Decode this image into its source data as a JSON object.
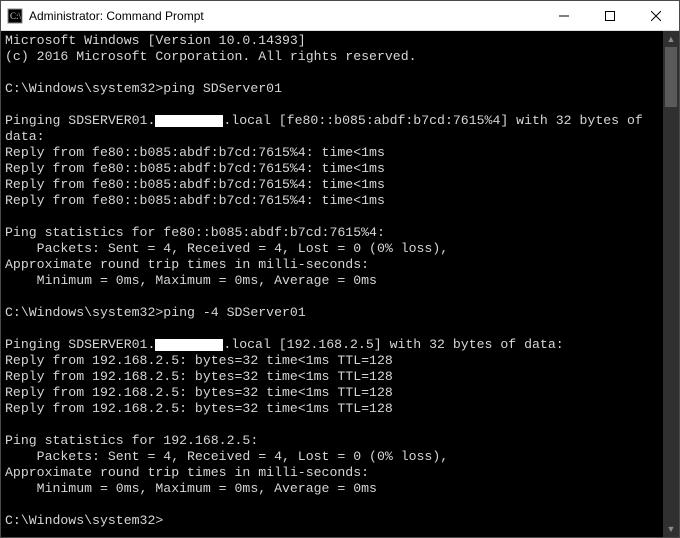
{
  "window": {
    "title": "Administrator: Command Prompt"
  },
  "terminal": {
    "header1": "Microsoft Windows [Version 10.0.14393]",
    "header2": "(c) 2016 Microsoft Corporation. All rights reserved.",
    "prompt_path": "C:\\Windows\\system32>",
    "cmd1": "ping SDServer01",
    "ping1": {
      "intro_a": "Pinging SDSERVER01.",
      "intro_b": ".local [fe80::b085:abdf:b7cd:7615%4] with 32 bytes of data:",
      "reply": "Reply from fe80::b085:abdf:b7cd:7615%4: time<1ms",
      "stats_title": "Ping statistics for fe80::b085:abdf:b7cd:7615%4:",
      "packets": "    Packets: Sent = 4, Received = 4, Lost = 0 (0% loss),",
      "approx": "Approximate round trip times in milli-seconds:",
      "times": "    Minimum = 0ms, Maximum = 0ms, Average = 0ms"
    },
    "cmd2": "ping -4 SDServer01",
    "ping2": {
      "intro_a": "Pinging SDSERVER01.",
      "intro_b": ".local [192.168.2.5] with 32 bytes of data:",
      "reply": "Reply from 192.168.2.5: bytes=32 time<1ms TTL=128",
      "stats_title": "Ping statistics for 192.168.2.5:",
      "packets": "    Packets: Sent = 4, Received = 4, Lost = 0 (0% loss),",
      "approx": "Approximate round trip times in milli-seconds:",
      "times": "    Minimum = 0ms, Maximum = 0ms, Average = 0ms"
    }
  }
}
